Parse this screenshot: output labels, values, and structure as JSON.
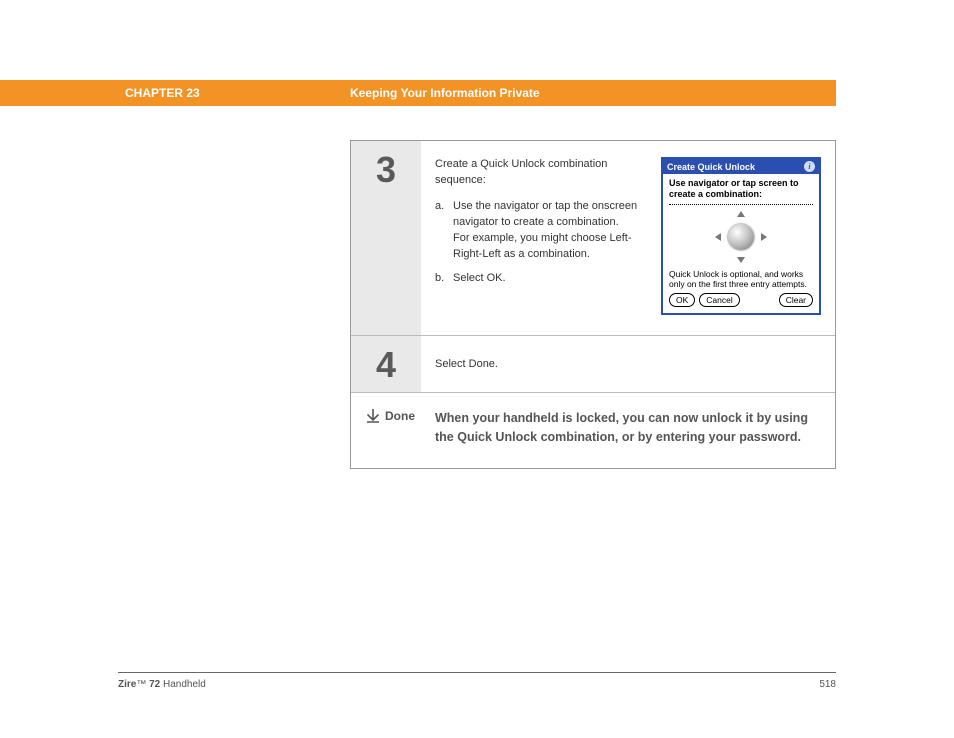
{
  "header": {
    "chapter": "CHAPTER 23",
    "title": "Keeping Your Information Private"
  },
  "steps": {
    "s3": {
      "num": "3",
      "intro": "Create a Quick Unlock combination sequence:",
      "a_lab": "a.",
      "a": "Use the navigator or tap the onscreen navigator to create a combination.\nFor example, you might choose Left-Right-Left as a combination.",
      "b_lab": "b.",
      "b": "Select OK."
    },
    "s4": {
      "num": "4",
      "text": "Select Done."
    },
    "done": {
      "label": "Done",
      "text": "When your handheld is locked, you can now unlock it by using the Quick Unlock combination, or by entering your password."
    }
  },
  "pda": {
    "title": "Create Quick Unlock",
    "instr": "Use navigator or tap screen to create a combination:",
    "note": "Quick Unlock is optional, and works only on the first three entry attempts.",
    "ok": "OK",
    "cancel": "Cancel",
    "clear": "Clear"
  },
  "footer": {
    "prod1": "Zire",
    "tm": "™",
    "prod2": " 72",
    "prod3": " Handheld",
    "page": "518"
  }
}
